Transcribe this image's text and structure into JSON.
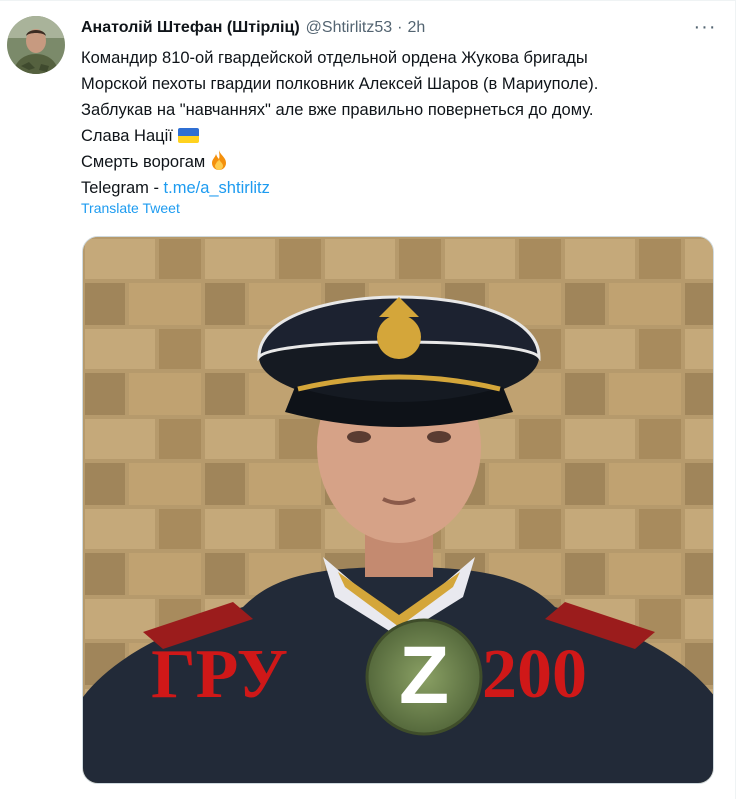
{
  "tweet": {
    "display_name": "Анатолій Штефан (Штірліц)",
    "handle": "@Shtirlitz53",
    "separator": "·",
    "time": "2h",
    "more": "···",
    "lines": [
      "Командир 810-ой гвардейской отдельной ордена Жукова бригады",
      "Морской пехоты гвардии полковник Алексей Шаров (в Мариуполе).",
      "Заблукав на \"навчаннях\" але вже правильно повернеться до дому."
    ],
    "slava": "Слава Нації",
    "smert": "Смерть ворогам",
    "telegram_prefix": "Telegram - ",
    "telegram_link": "t.me/a_shtirlitz",
    "translate": "Translate Tweet"
  },
  "media": {
    "overlay_left": "ГРУ",
    "overlay_z": "Z",
    "overlay_right": "200"
  },
  "icons": {
    "flag": "ukraine-flag-icon",
    "fire": "fire-icon",
    "more": "more-icon"
  },
  "colors": {
    "link": "#1d9bf0",
    "muted": "#536471",
    "overlay_red": "#d01818",
    "patch_green": "#6f8a50"
  }
}
